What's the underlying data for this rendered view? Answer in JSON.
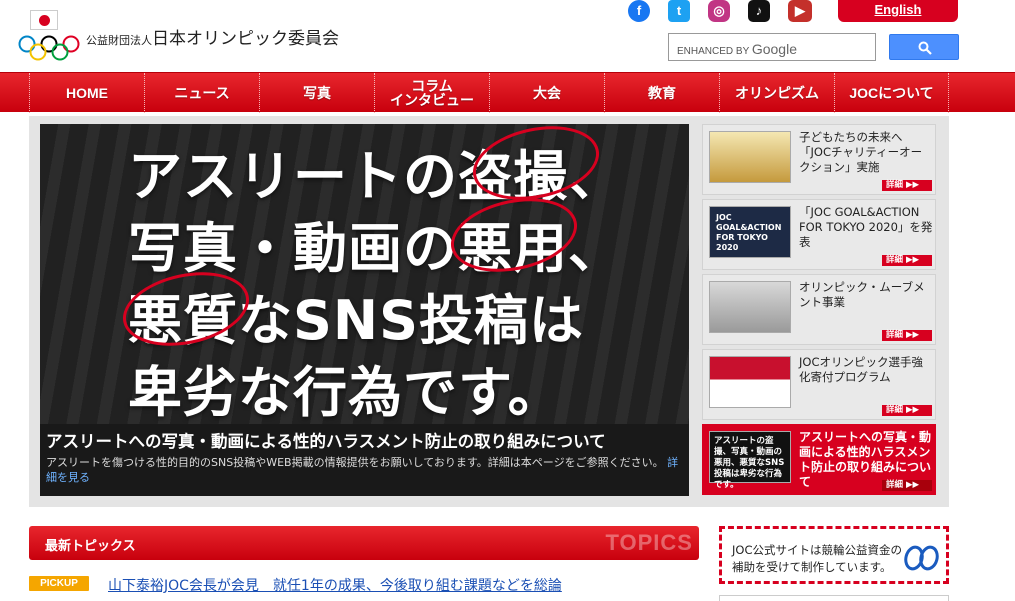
{
  "header": {
    "org_prefix": "公益財団法人",
    "org_name": "日本オリンピック委員会",
    "english_label": "English",
    "search_placeholder_prefix": "ENHANCED BY",
    "search_placeholder_brand": "Google",
    "social": [
      {
        "icon": "facebook-icon",
        "glyph": "f"
      },
      {
        "icon": "twitter-icon",
        "glyph": "t"
      },
      {
        "icon": "instagram-icon",
        "glyph": "◎"
      },
      {
        "icon": "tiktok-icon",
        "glyph": "♪"
      },
      {
        "icon": "youtube-icon",
        "glyph": "▶"
      }
    ]
  },
  "nav": {
    "items": [
      {
        "label": "HOME"
      },
      {
        "label": "ニュース"
      },
      {
        "label": "写真"
      },
      {
        "label": "コラム\nインタビュー"
      },
      {
        "label": "大会"
      },
      {
        "label": "教育"
      },
      {
        "label": "オリンピズム"
      },
      {
        "label": "JOCについて"
      }
    ]
  },
  "hero": {
    "lines": [
      "アスリートの盗撮、",
      "写真・動画の悪用、",
      "悪質なSNS投稿は",
      "卑劣な行為です。"
    ],
    "caption_title": "アスリートへの写真・動画による性的ハラスメント防止の取り組みについて",
    "caption_body": "アスリートを傷つける性的目的のSNS投稿やWEB掲載の情報提供をお願いしております。詳細は本ページをご参照ください。",
    "caption_link": "詳細を見る"
  },
  "side": {
    "more_label": "詳細 ▶▶",
    "items": [
      {
        "text": "子どもたちの未来へ「JOCチャリティーオークション」実施",
        "thumb_text": ""
      },
      {
        "text": "「JOC GOAL&ACTION FOR TOKYO 2020」を発表",
        "thumb_text": "JOC GOAL&ACTION FOR TOKYO 2020"
      },
      {
        "text": "オリンピック・ムーブメント事業",
        "thumb_text": ""
      },
      {
        "text": "JOCオリンピック選手強化寄付プログラム",
        "thumb_text": ""
      },
      {
        "text": "アスリートへの写真・動画による性的ハラスメント防止の取り組みについて",
        "thumb_text": "アスリートの盗撮、写真・動画の悪用、悪質なSNS投稿は卑劣な行為です。"
      }
    ]
  },
  "topics": {
    "title": "最新トピックス",
    "watermark": "TOPICS",
    "pickup_label": "PICKUP",
    "pickup_text": "山下泰裕JOC会長が会見　就任1年の成果、今後取り組む課題などを総論"
  },
  "keirin": {
    "line1": "JOC公式サイトは競輪公益資金の",
    "line2": "補助を受けて制作しています。"
  }
}
